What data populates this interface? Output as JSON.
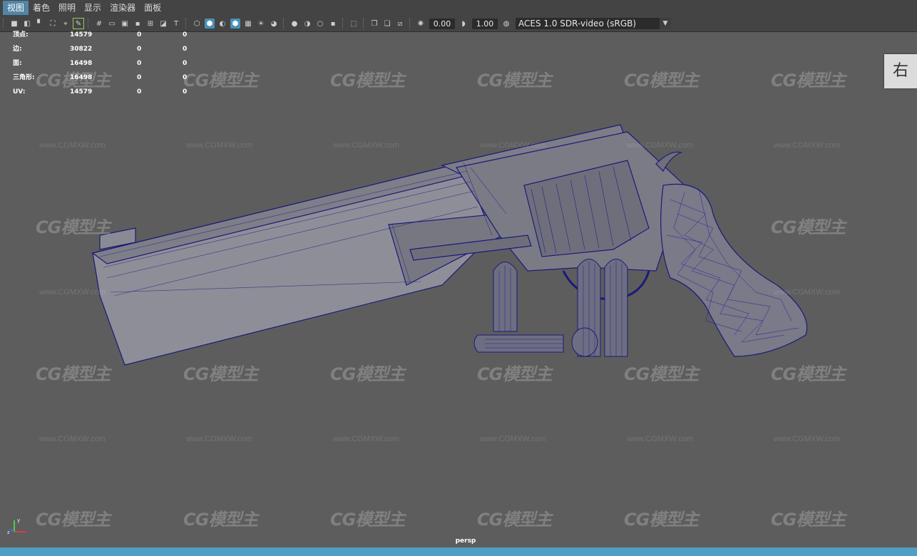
{
  "menu": [
    {
      "label": "视图",
      "active": true
    },
    {
      "label": "着色"
    },
    {
      "label": "照明"
    },
    {
      "label": "显示"
    },
    {
      "label": "渲染器"
    },
    {
      "label": "面板"
    }
  ],
  "toolbar": {
    "exposure": "0.00",
    "gamma": "1.00",
    "color_space": "ACES 1.0 SDR-video (sRGB)"
  },
  "hud": [
    {
      "label": "顶点:",
      "v1": "14579",
      "v2": "0",
      "v3": "0"
    },
    {
      "label": "边:",
      "v1": "30822",
      "v2": "0",
      "v3": "0"
    },
    {
      "label": "面:",
      "v1": "16498",
      "v2": "0",
      "v3": "0"
    },
    {
      "label": "三角形:",
      "v1": "16498",
      "v2": "0",
      "v3": "0"
    },
    {
      "label": "UV:",
      "v1": "14579",
      "v2": "0",
      "v3": "0"
    }
  ],
  "viewcube_label": "右",
  "camera": "persp",
  "watermark": {
    "logo": "CG模型主",
    "url": "www.CGMXW.com"
  },
  "axis": {
    "x": "x",
    "y": "y",
    "z": "z"
  },
  "colors": {
    "viewport_bg": "#5d5d5d",
    "wireframe": "#1a1a7a",
    "model_fill": "#8e8e98",
    "accent": "#4a90b8"
  }
}
